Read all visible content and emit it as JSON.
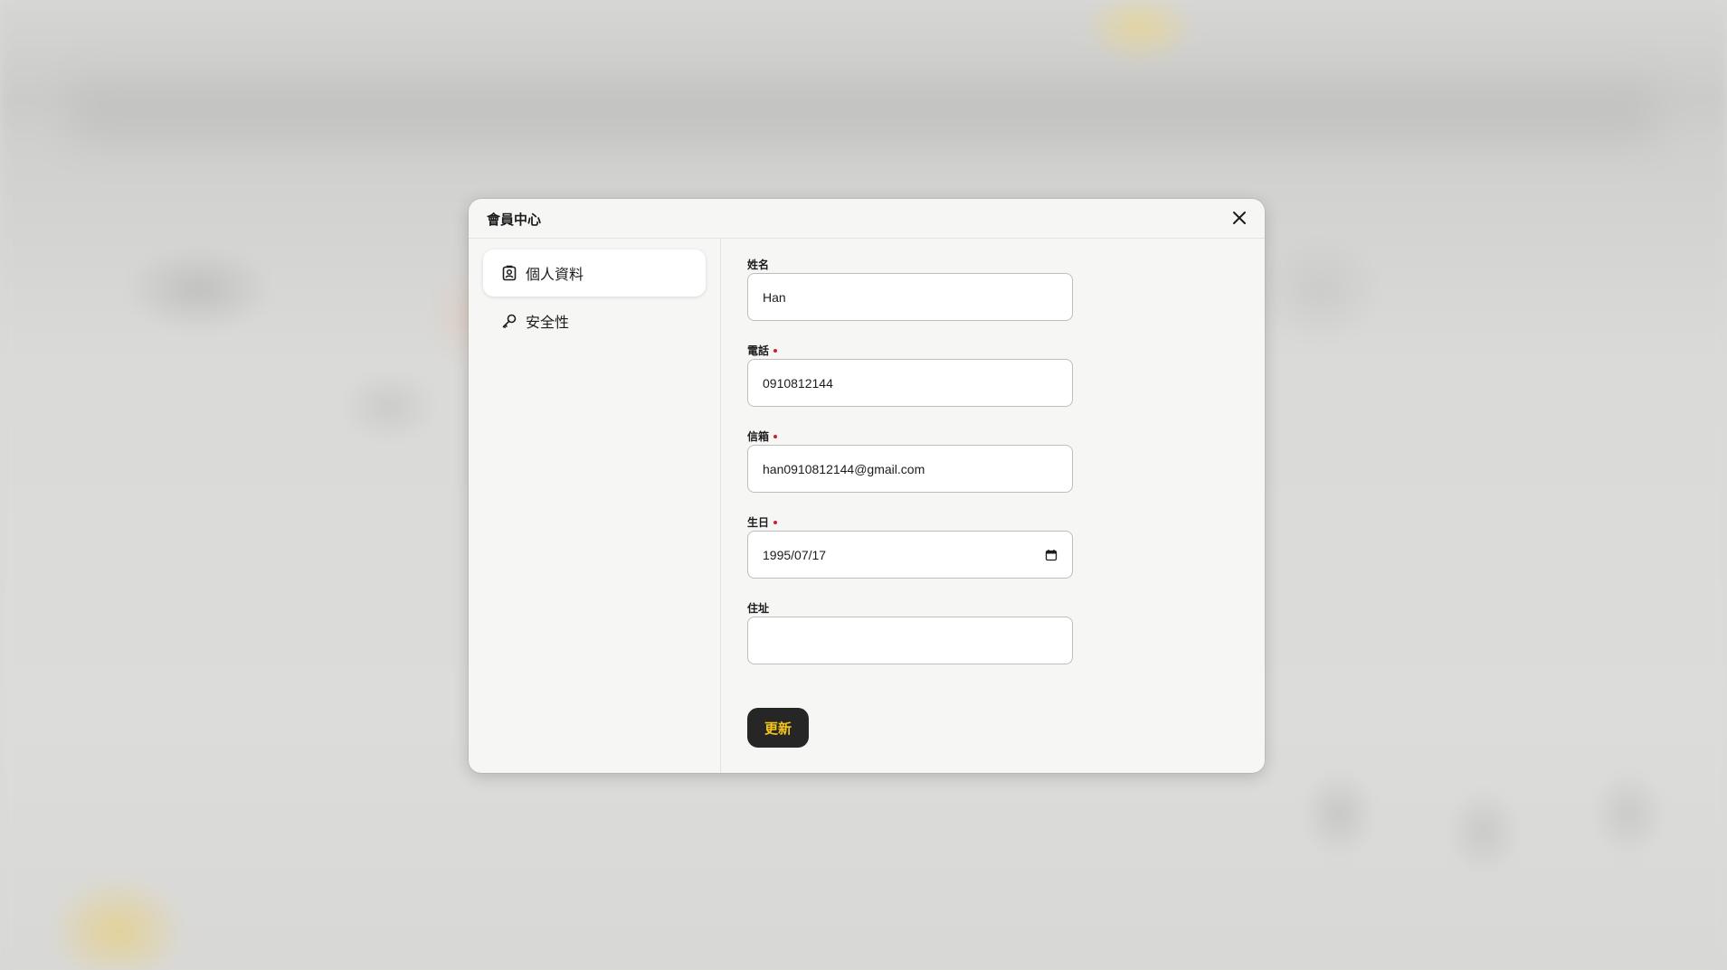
{
  "modal": {
    "title": "會員中心",
    "close_icon": "close-icon"
  },
  "sidebar": {
    "items": [
      {
        "label": "個人資料",
        "icon": "user-badge-icon",
        "active": true
      },
      {
        "label": "安全性",
        "icon": "key-icon",
        "active": false
      }
    ]
  },
  "form": {
    "fields": [
      {
        "label": "姓名",
        "required": false,
        "value": "Han"
      },
      {
        "label": "電話",
        "required": true,
        "value": "0910812144"
      },
      {
        "label": "信箱",
        "required": true,
        "value": "han0910812144@gmail.com"
      },
      {
        "label": "生日",
        "required": true,
        "value": "1995/07/17",
        "icon": "calendar-icon"
      },
      {
        "label": "住址",
        "required": false,
        "value": ""
      }
    ],
    "submit_label": "更新"
  },
  "colors": {
    "required_dot": "#d21b35",
    "button_bg": "#262626",
    "button_text": "#f5c518"
  }
}
